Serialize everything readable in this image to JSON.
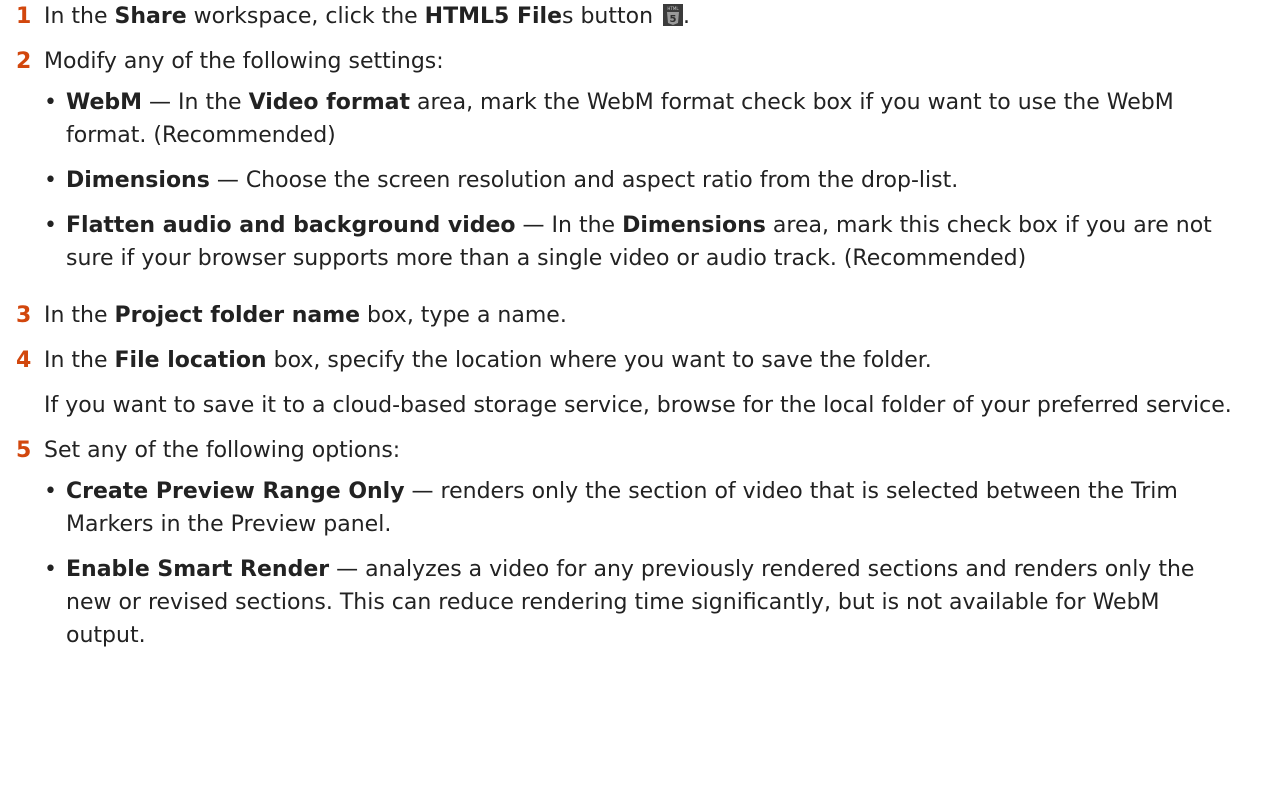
{
  "steps": [
    {
      "num": "1",
      "parts": [
        "In the ",
        "Share",
        " workspace, click the ",
        "HTML5 File",
        "s button",
        "."
      ]
    },
    {
      "num": "2",
      "text": "Modify any of the following settings:",
      "bullets": [
        {
          "bold": "WebM",
          "text": " — In the ",
          "bold2": "Video format",
          "text2": " area, mark the WebM format check box if you want to use the WebM format. (Recommended)"
        },
        {
          "bold": "Dimensions",
          "text": " — Choose the screen resolution and aspect ratio from the drop-list."
        },
        {
          "bold": "Flatten audio and background video",
          "text": " — In the ",
          "bold2": "Dimensions",
          "text2": " area, mark this check box if you are not sure if your browser supports more than a single video or audio track. (Recommended)"
        }
      ]
    },
    {
      "num": "3",
      "parts": [
        "In the ",
        "Project folder name",
        " box, type a name."
      ]
    },
    {
      "num": "4",
      "parts": [
        "In the ",
        "File location",
        " box, specify the location where you want to save the folder."
      ],
      "note": "If you want to save it to a cloud-based storage service, browse for the local folder of your preferred service."
    },
    {
      "num": "5",
      "text": "Set any of the following options:",
      "bullets": [
        {
          "bold": "Create Preview Range Only",
          "text": " — renders only the section of video that is selected between the Trim Markers in the Preview panel."
        },
        {
          "bold": "Enable Smart Render",
          "text": " — analyzes a video for any previously rendered sections and renders only the new or revised sections. This can reduce rendering time significantly, but is not available for WebM output."
        }
      ]
    }
  ],
  "icons": {
    "html5": "html5-icon"
  },
  "bullet_char": "•",
  "colors": {
    "step_number": "#d2470d",
    "text": "#222222",
    "icon_bg": "#3b3b3b"
  }
}
